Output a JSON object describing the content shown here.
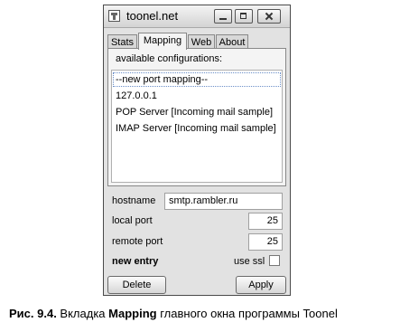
{
  "window": {
    "title": "toonel.net"
  },
  "tabs": [
    {
      "label": "Stats",
      "active": false
    },
    {
      "label": "Mapping",
      "active": true
    },
    {
      "label": "Web",
      "active": false
    },
    {
      "label": "About",
      "active": false
    }
  ],
  "configurations": {
    "label": "available configurations:",
    "items": [
      {
        "label": "--new port mapping--",
        "selected": true
      },
      {
        "label": "127.0.0.1",
        "selected": false
      },
      {
        "label": "POP  Server [Incoming mail sample]",
        "selected": false
      },
      {
        "label": "IMAP Server [Incoming mail sample]",
        "selected": false
      }
    ]
  },
  "form": {
    "hostname_label": "hostname",
    "hostname_value": "smtp.rambler.ru",
    "local_port_label": "local port",
    "local_port_value": "25",
    "remote_port_label": "remote port",
    "remote_port_value": "25",
    "new_entry_label": "new entry",
    "use_ssl_label": "use ssl",
    "use_ssl_checked": false
  },
  "buttons": {
    "delete": "Delete",
    "apply": "Apply"
  },
  "caption": {
    "prefix": "Рис. 9.4.",
    "text_before": " Вкладка ",
    "highlight": "Mapping",
    "text_after": " главного окна программы Toonel"
  }
}
